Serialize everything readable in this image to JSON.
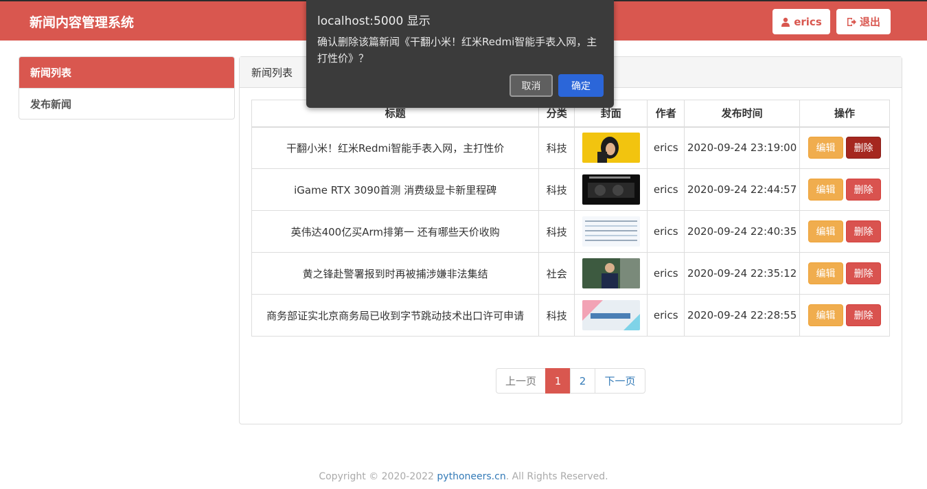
{
  "header": {
    "title": "新闻内容管理系统",
    "user_label": "erics",
    "logout_label": "退出"
  },
  "sidebar": {
    "items": [
      {
        "label": "新闻列表"
      },
      {
        "label": "发布新闻"
      }
    ]
  },
  "panel": {
    "heading": "新闻列表"
  },
  "table": {
    "columns": [
      "标题",
      "分类",
      "封面",
      "作者",
      "发布时间",
      "操作"
    ],
    "rows": [
      {
        "title": "干翻小米！红米Redmi智能手表入网，主打性价",
        "category": "科技",
        "author": "erics",
        "time": "2020-09-24 23:19:00",
        "edit": "编辑",
        "delete": "删除"
      },
      {
        "title": "iGame RTX 3090首测 消费级显卡新里程碑",
        "category": "科技",
        "author": "erics",
        "time": "2020-09-24 22:44:57",
        "edit": "编辑",
        "delete": "删除"
      },
      {
        "title": "英伟达400亿买Arm排第一 还有哪些天价收购",
        "category": "科技",
        "author": "erics",
        "time": "2020-09-24 22:40:35",
        "edit": "编辑",
        "delete": "删除"
      },
      {
        "title": "黄之锋赴警署报到时再被捕涉嫌非法集结",
        "category": "社会",
        "author": "erics",
        "time": "2020-09-24 22:35:12",
        "edit": "编辑",
        "delete": "删除"
      },
      {
        "title": "商务部证实北京商务局已收到字节跳动技术出口许可申请",
        "category": "科技",
        "author": "erics",
        "time": "2020-09-24 22:28:55",
        "edit": "编辑",
        "delete": "删除"
      }
    ]
  },
  "pagination": {
    "prev": "上一页",
    "pages": [
      "1",
      "2"
    ],
    "next": "下一页",
    "current": "1"
  },
  "footer": {
    "text_before": "Copyright © 2020-2022 ",
    "link": "pythoneers.cn",
    "text_after": ". All Rights Reserved."
  },
  "dialog": {
    "title": "localhost:5000 显示",
    "message": "确认删除该篇新闻《干翻小米！红米Redmi智能手表入网，主打性价》？",
    "cancel": "取消",
    "ok": "确定"
  },
  "colors": {
    "brand": "#d9574f",
    "edit": "#f0ad4e",
    "delete": "#d9534f",
    "dialog_bg": "#3b3b3b",
    "dialog_ok": "#2b66d9"
  }
}
